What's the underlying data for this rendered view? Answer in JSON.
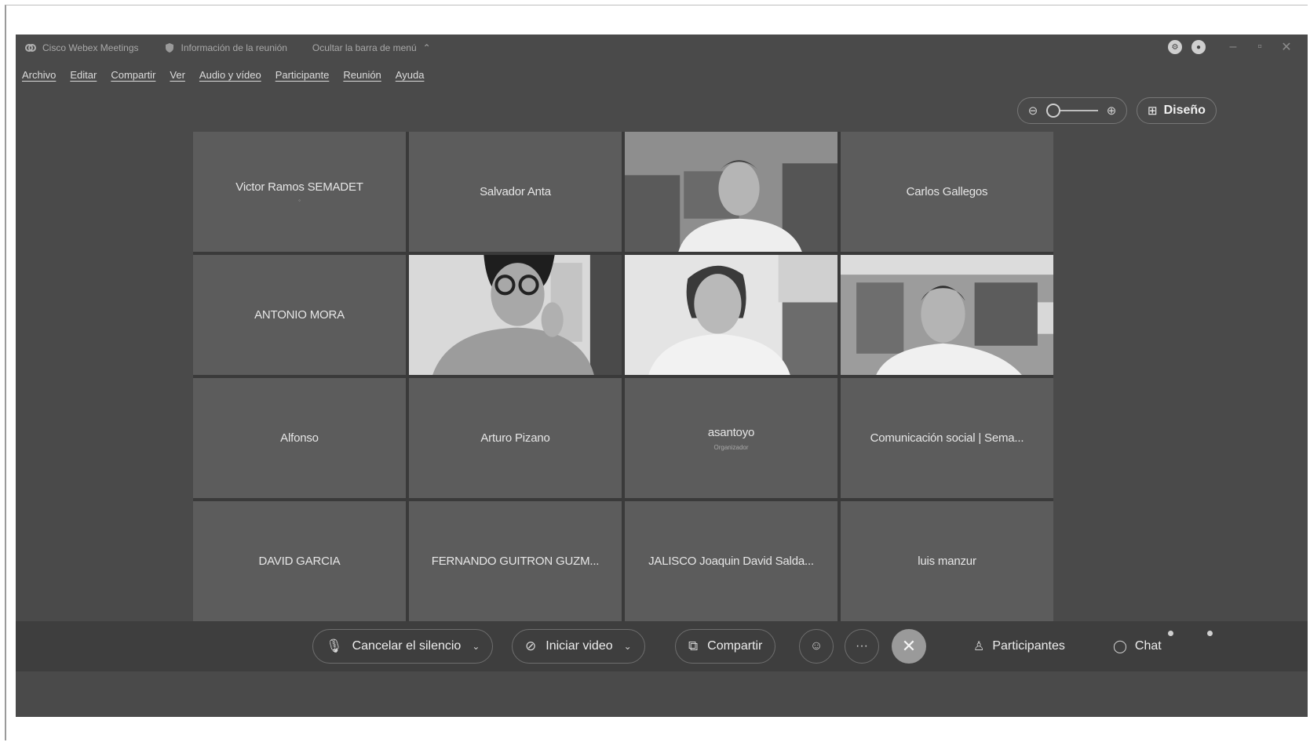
{
  "window": {
    "title": "Cisco Webex Meetings",
    "meeting_info": "Información de la reunión",
    "hide_menu": "Ocultar la barra de menú"
  },
  "menu": [
    "Archivo",
    "Editar",
    "Compartir",
    "Ver",
    "Audio y vídeo",
    "Participante",
    "Reunión",
    "Ayuda"
  ],
  "controls": {
    "layout_label": "Diseño"
  },
  "participants": [
    {
      "name": "Victor Ramos SEMADET",
      "role": "",
      "video": false
    },
    {
      "name": "Salvador Anta",
      "role": "",
      "video": false
    },
    {
      "name": "",
      "role": "",
      "video": true
    },
    {
      "name": "Carlos Gallegos",
      "role": "",
      "video": false
    },
    {
      "name": "ANTONIO MORA",
      "role": "",
      "video": false
    },
    {
      "name": "",
      "role": "",
      "video": true
    },
    {
      "name": "",
      "role": "",
      "video": true
    },
    {
      "name": "",
      "role": "",
      "video": true
    },
    {
      "name": "Alfonso",
      "role": "",
      "video": false
    },
    {
      "name": "Arturo Pizano",
      "role": "",
      "video": false
    },
    {
      "name": "asantoyo",
      "role": "Organizador",
      "video": false
    },
    {
      "name": "Comunicación social | Sema...",
      "role": "",
      "video": false
    },
    {
      "name": "DAVID GARCIA",
      "role": "",
      "video": false
    },
    {
      "name": "FERNANDO GUITRON GUZM...",
      "role": "",
      "video": false
    },
    {
      "name": "JALISCO Joaquin David Salda...",
      "role": "",
      "video": false
    },
    {
      "name": "luis manzur",
      "role": "",
      "video": false
    }
  ],
  "toolbar": {
    "unmute": "Cancelar el silencio",
    "start_video": "Iniciar video",
    "share": "Compartir",
    "participants": "Participantes",
    "chat": "Chat"
  }
}
